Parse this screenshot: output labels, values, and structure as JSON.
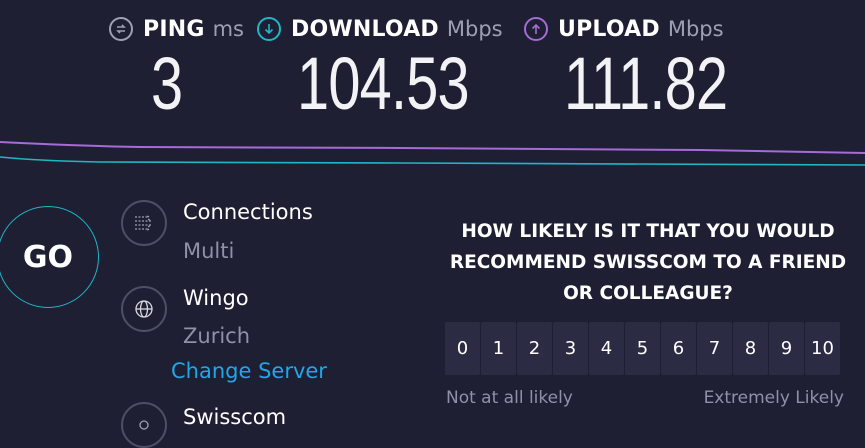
{
  "metrics": {
    "ping": {
      "name": "PING",
      "unit": "ms",
      "value": "3",
      "icon": "ping-icon"
    },
    "download": {
      "name": "DOWNLOAD",
      "unit": "Mbps",
      "value": "104.53",
      "icon": "download-arrow-icon"
    },
    "upload": {
      "name": "UPLOAD",
      "unit": "Mbps",
      "value": "111.82",
      "icon": "upload-arrow-icon"
    }
  },
  "colors": {
    "download": "#1fb7c5",
    "upload": "#a56bd8",
    "link": "#20a7e8"
  },
  "go_label": "GO",
  "connections": {
    "title": "Connections",
    "value": "Multi",
    "icon": "connections-icon"
  },
  "server": {
    "name": "Wingo",
    "location": "Zurich",
    "change_label": "Change Server",
    "icon": "globe-icon"
  },
  "provider": {
    "name": "Swisscom",
    "icon": "user-icon"
  },
  "survey": {
    "question_lines": [
      "HOW LIKELY IS IT THAT YOU WOULD",
      "RECOMMEND SWISSCOM TO A FRIEND",
      "OR COLLEAGUE?"
    ],
    "options": [
      "0",
      "1",
      "2",
      "3",
      "4",
      "5",
      "6",
      "7",
      "8",
      "9",
      "10"
    ],
    "low_label": "Not at all likely",
    "high_label": "Extremely Likely"
  }
}
